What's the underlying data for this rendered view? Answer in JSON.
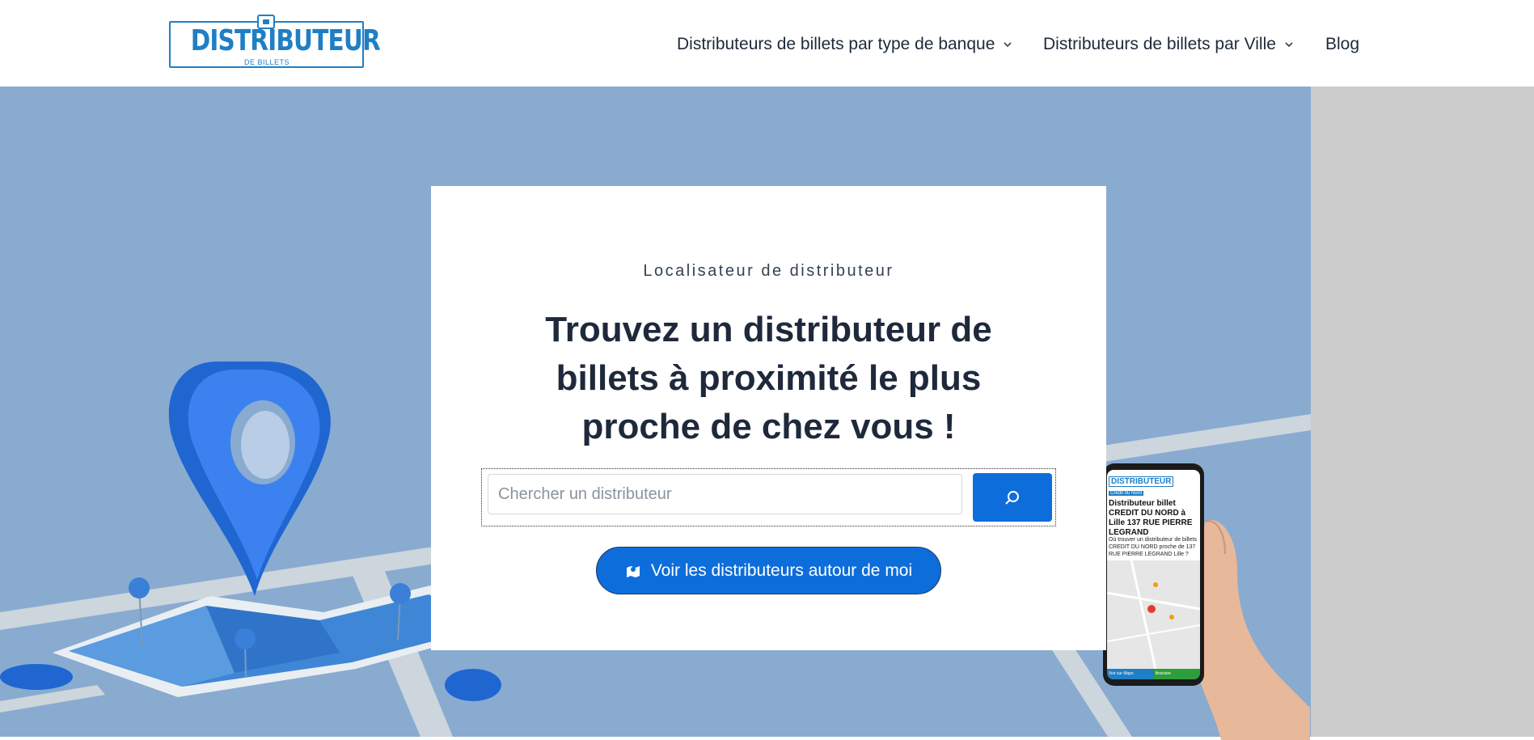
{
  "header": {
    "logo": {
      "word": "DISTRIBUTEUR",
      "sub": "DE BILLETS"
    },
    "nav": [
      {
        "label": "Distributeurs de billets par type de banque",
        "has_dropdown": true,
        "icon": "chevron-down-icon"
      },
      {
        "label": "Distributeurs de billets par Ville",
        "has_dropdown": true,
        "icon": "chevron-down-icon"
      },
      {
        "label": "Blog",
        "has_dropdown": false
      }
    ]
  },
  "hero": {
    "eyebrow": "Localisateur de distributeur",
    "headline": "Trouvez un distributeur de billets à proximité le plus proche de chez vous !",
    "search": {
      "placeholder": "Chercher un distributeur",
      "button_icon": "search-icon"
    },
    "nearby_button": {
      "label": "Voir les distributeurs autour de moi",
      "icon": "map-pin-icon"
    }
  },
  "phone_screen": {
    "logo": "DISTRIBUTEUR",
    "tag": "Crédit du Nord",
    "title": "Distributeur billet CREDIT DU NORD à Lille 137 RUE PIERRE LEGRAND",
    "text": "Où trouver un distributeur de billets CREDIT DU NORD proche de 137 RUE PIERRE LEGRAND Lille ?",
    "bar_left": "Voir sur Maps",
    "bar_right": "Itinéraire"
  },
  "colors": {
    "brand": "#1f7fc4",
    "accent": "#0d6edb",
    "hero_bg": "#89abd0",
    "side_strip": "#cccccc"
  }
}
